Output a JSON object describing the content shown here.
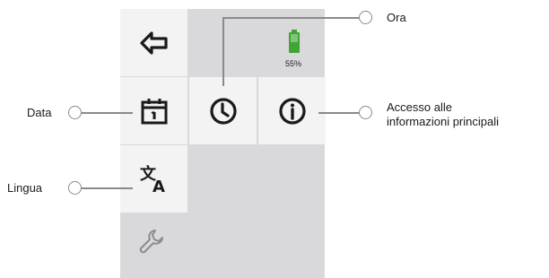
{
  "battery": {
    "percent_label": "55%",
    "level": 0.55,
    "color": "#3fa535"
  },
  "labels": {
    "ora": "Ora",
    "data": "Data",
    "lingua": "Lingua",
    "accesso_line1": "Accesso alle",
    "accesso_line2": "informazioni principali"
  },
  "icons": {
    "back": "back-arrow-icon",
    "calendar": "calendar-icon",
    "clock": "clock-icon",
    "info": "info-icon",
    "language": "translate-icon",
    "settings": "wrench-icon"
  },
  "colors": {
    "panel": "#d9d8da",
    "tile": "#f4f3f4",
    "callout": "#8a8a8a"
  }
}
